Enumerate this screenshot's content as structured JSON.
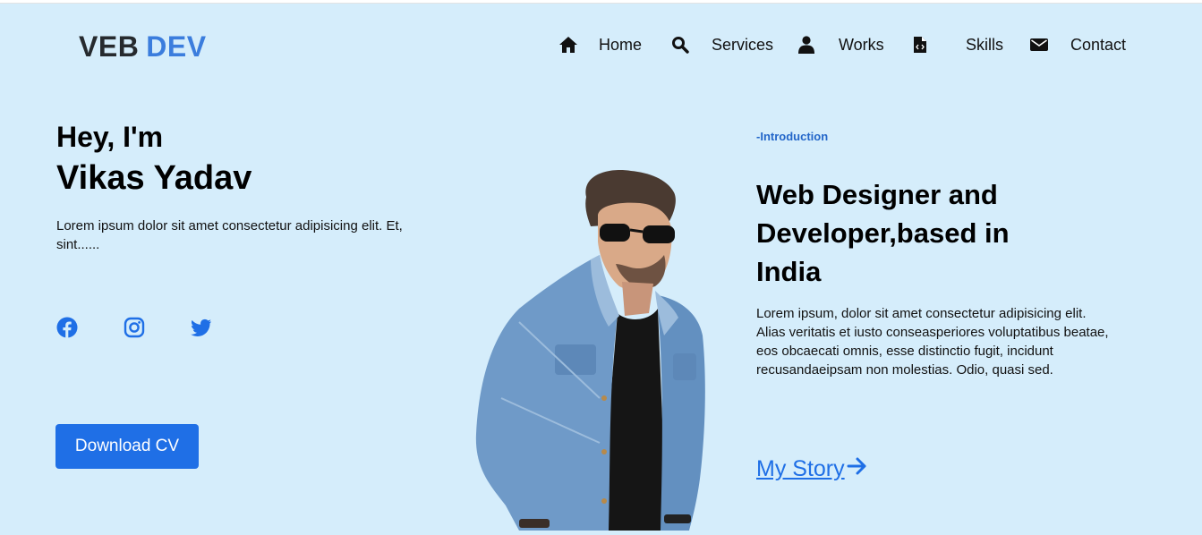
{
  "brand": {
    "part1": "VEB",
    "part2": "DEV",
    "accent": "#3b7ddd"
  },
  "nav": [
    {
      "label": "Home",
      "icon": "home-icon"
    },
    {
      "label": "Services",
      "icon": "search-icon"
    },
    {
      "label": "Works",
      "icon": "user-icon"
    },
    {
      "label": "Skills",
      "icon": "code-file-icon"
    },
    {
      "label": "Contact",
      "icon": "envelope-icon"
    }
  ],
  "hero": {
    "greeting": "Hey, I'm",
    "name": "Vikas Yadav",
    "intro": "Lorem ipsum dolor sit amet consectetur adipisicing elit. Et, sint......",
    "social": [
      "facebook-icon",
      "instagram-icon",
      "twitter-icon"
    ],
    "cta": "Download CV"
  },
  "about": {
    "tag": "-Introduction",
    "headline": "Web Designer and Developer,based in India",
    "body": "Lorem ipsum, dolor sit amet consectetur adipisicing elit. Alias veritatis et iusto conseasperiores voluptatibus beatae, eos obcaecati omnis, esse distinctio fugit, incidunt recusandaeipsam non molestias. Odio, quasi sed.",
    "link": "My Story "
  },
  "colors": {
    "background": "#d5edfb",
    "primary": "#1f6fe6"
  }
}
